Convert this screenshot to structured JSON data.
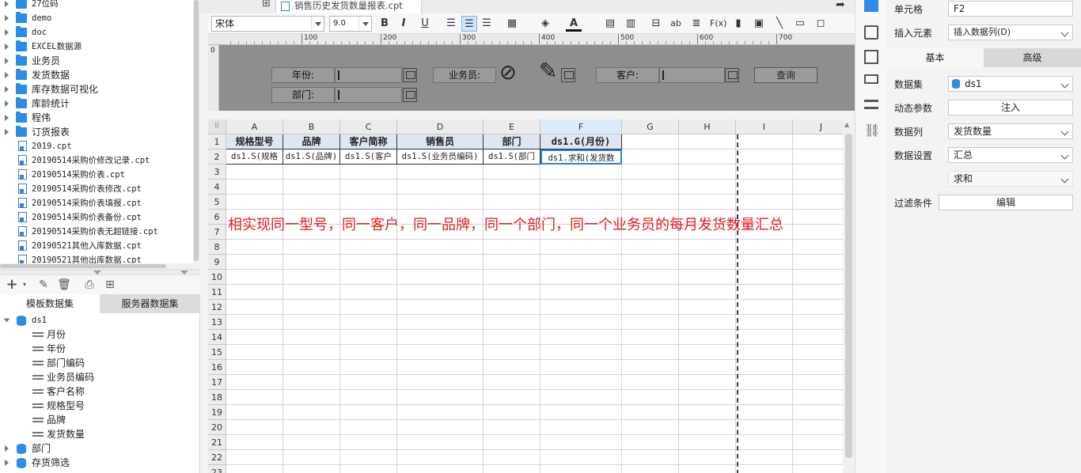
{
  "file_tree": {
    "folders": [
      "27位码",
      "demo",
      "doc",
      "EXCEL数据源",
      "业务员",
      "发货数据",
      "库存数据可视化",
      "库龄统计",
      "程伟",
      "订货报表"
    ],
    "files": [
      "2019.cpt",
      "20190514采购价修改记录.cpt",
      "20190514采购价表.cpt",
      "20190514采购价表修改.cpt",
      "20190514采购价表填报.cpt",
      "20190514采购价表备份.cpt",
      "20190514采购价表无超链接.cpt",
      "20190521其他入库数据.cpt",
      "20190521其他出库数据.cpt"
    ]
  },
  "dataset_panel": {
    "tabs": [
      "模板数据集",
      "服务器数据集"
    ],
    "active_tab": 0,
    "dataset": "ds1",
    "fields": [
      "月份",
      "年份",
      "部门编码",
      "业务员编码",
      "客户名称",
      "规格型号",
      "品牌",
      "发货数量"
    ],
    "other_datasets": [
      "部门",
      "存货筛选"
    ]
  },
  "editor_tab": {
    "title": "销售历史发货数量报表.cpt"
  },
  "toolbar": {
    "font_name": "宋体",
    "font_size": "9.0"
  },
  "ruler": {
    "marks": [
      "0",
      "100",
      "200",
      "300",
      "400",
      "500",
      "600",
      "700"
    ]
  },
  "params": {
    "year_label": "年份:",
    "salesman_label": "业务员:",
    "customer_label": "客户:",
    "dept_label": "部门:",
    "query_button": "查询"
  },
  "grid": {
    "columns": [
      "A",
      "B",
      "C",
      "D",
      "E",
      "F",
      "G",
      "H",
      "I",
      "J"
    ],
    "selected_column": "F",
    "rows": [
      "1",
      "2",
      "3",
      "4",
      "5",
      "6",
      "7",
      "8",
      "9",
      "10",
      "11",
      "12",
      "13",
      "14",
      "15",
      "16",
      "17",
      "18",
      "19",
      "20",
      "21",
      "22",
      "23"
    ],
    "header_row": [
      "规格型号",
      "品牌",
      "客户简称",
      "销售员",
      "部门",
      "ds1.G(月份)"
    ],
    "data_row": [
      "ds1.S(规格",
      "ds1.S(品牌)",
      "ds1.S(客户",
      "ds1.S(业务员编码)",
      "ds1.S(部门",
      "ds1.求和(发货数"
    ],
    "annotation": "相实现同一型号，同一客户，同一品牌，同一个部门，同一个业务员的每月发货数量汇总"
  },
  "properties": {
    "cell_label": "单元格",
    "cell_value": "F2",
    "insert_label": "插入元素",
    "insert_value": "插入数据列(D)",
    "tabs": [
      "基本",
      "高级"
    ],
    "dataset_label": "数据集",
    "dataset_value": "ds1",
    "dynamic_label": "动态参数",
    "dynamic_button": "注入",
    "column_label": "数据列",
    "column_value": "发货数量",
    "setting_label": "数据设置",
    "setting_value": "汇总",
    "agg_value": "求和",
    "filter_label": "过滤条件",
    "filter_button": "编辑"
  },
  "colors": {
    "accent": "#2d8ce6",
    "annotation": "#e02020",
    "header_fill": "#dfe6f3",
    "param_bg": "#8e8e8e"
  }
}
